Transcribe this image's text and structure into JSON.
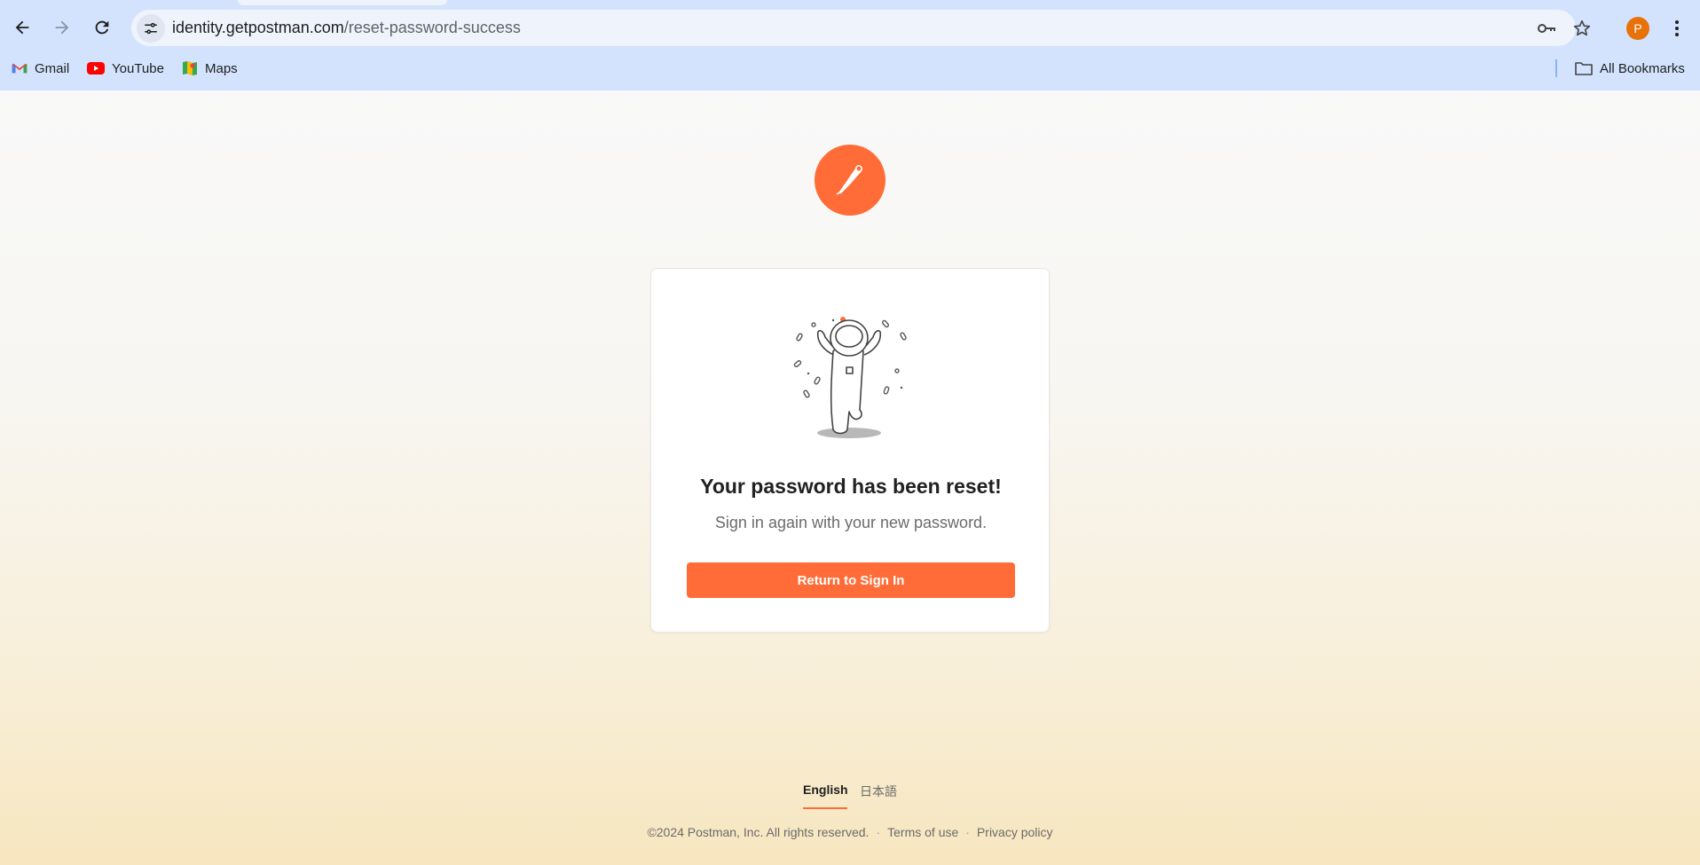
{
  "browser": {
    "url_host": "identity.getpostman.com",
    "url_path": "/reset-password-success",
    "profile_initial": "P",
    "bookmarks": [
      {
        "label": "Gmail",
        "icon": "gmail-icon"
      },
      {
        "label": "YouTube",
        "icon": "youtube-icon"
      },
      {
        "label": "Maps",
        "icon": "maps-icon"
      }
    ],
    "all_bookmarks_label": "All Bookmarks"
  },
  "main": {
    "title": "Your password has been reset!",
    "subtitle": "Sign in again with your new password.",
    "return_button_label": "Return to Sign In"
  },
  "languages": [
    {
      "label": "English",
      "active": true
    },
    {
      "label": "日本語",
      "active": false
    }
  ],
  "footer": {
    "copyright": "©2024 Postman, Inc. All rights reserved.",
    "terms_label": "Terms of use",
    "privacy_label": "Privacy policy"
  },
  "colors": {
    "brand_orange": "#ff6c37",
    "chrome_blue": "#d3e3fd"
  }
}
